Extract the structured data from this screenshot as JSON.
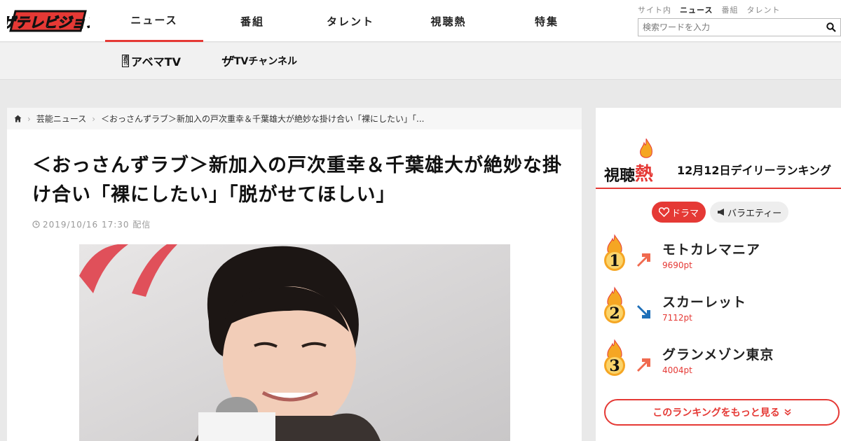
{
  "logo": {
    "text": "ザテレビジョン"
  },
  "nav": {
    "items": [
      {
        "label": "ニュース"
      },
      {
        "label": "番組"
      },
      {
        "label": "タレント"
      },
      {
        "label": "視聴熱"
      },
      {
        "label": "特集"
      }
    ]
  },
  "util": {
    "links": [
      "サイト内",
      "ニュース",
      "番組",
      "タレント"
    ],
    "search_placeholder": "検索ワードを入力"
  },
  "subnav": {
    "abema_small": "週刊",
    "abema": "アベマTV",
    "zatv_prefix": "ザ",
    "zatv": "TVチャンネル"
  },
  "breadcrumb": {
    "items": [
      "芸能ニュース",
      "＜おっさんずラブ＞新加入の戸次重幸＆千葉雄大が絶妙な掛け合い「裸にしたい」「..."
    ]
  },
  "article": {
    "title": "＜おっさんずラブ＞新加入の戸次重幸＆千葉雄大が絶妙な掛け合い「裸にしたい」「脱がせてほしい」",
    "date": "2019/10/16 17:30 配信"
  },
  "ranking": {
    "logo_main": "視聴",
    "logo_hot": "熱",
    "subtitle": "12月12日デイリーランキング",
    "tabs": [
      "ドラマ",
      "バラエティー"
    ],
    "items": [
      {
        "rank": "1",
        "name": "モトカレマニア",
        "points": "9690pt",
        "trend": "up"
      },
      {
        "rank": "2",
        "name": "スカーレット",
        "points": "7112pt",
        "trend": "down"
      },
      {
        "rank": "3",
        "name": "グランメゾン東京",
        "points": "4004pt",
        "trend": "up"
      }
    ],
    "more_label": "このランキングをもっと見る"
  },
  "colors": {
    "accent": "#e53935",
    "trend_up": "#f06a4f",
    "trend_down": "#1e6fb8",
    "medal": "#f5a623"
  }
}
